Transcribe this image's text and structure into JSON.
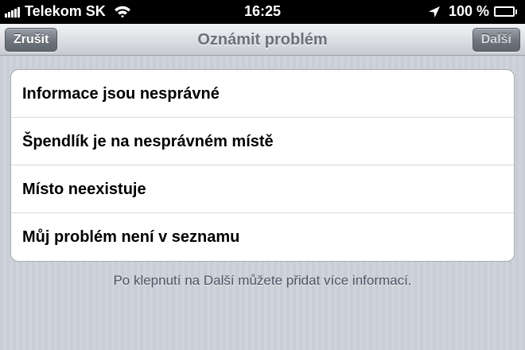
{
  "status_bar": {
    "carrier": "Telekom SK",
    "time": "16:25",
    "battery": "100 %",
    "battery_level": 1.0,
    "signal_bars": 5,
    "icons": [
      "signal-icon",
      "wifi-icon",
      "location-arrow-icon",
      "battery-icon"
    ]
  },
  "nav": {
    "title": "Oznámit problém",
    "cancel_label": "Zrušit",
    "next_label": "Další",
    "next_enabled": false
  },
  "options": [
    {
      "label": "Informace jsou nesprávné"
    },
    {
      "label": "Špendlík je na nesprávném místě"
    },
    {
      "label": "Místo neexistuje"
    },
    {
      "label": "Můj problém není v seznamu"
    }
  ],
  "footer": {
    "note": "Po klepnutí na Další můžete přidat více informací."
  },
  "colors": {
    "status_bar_bg": "#000000",
    "background": "#cbcfd7",
    "nav_title": "#6b7079",
    "footer_text": "#4c5566"
  }
}
